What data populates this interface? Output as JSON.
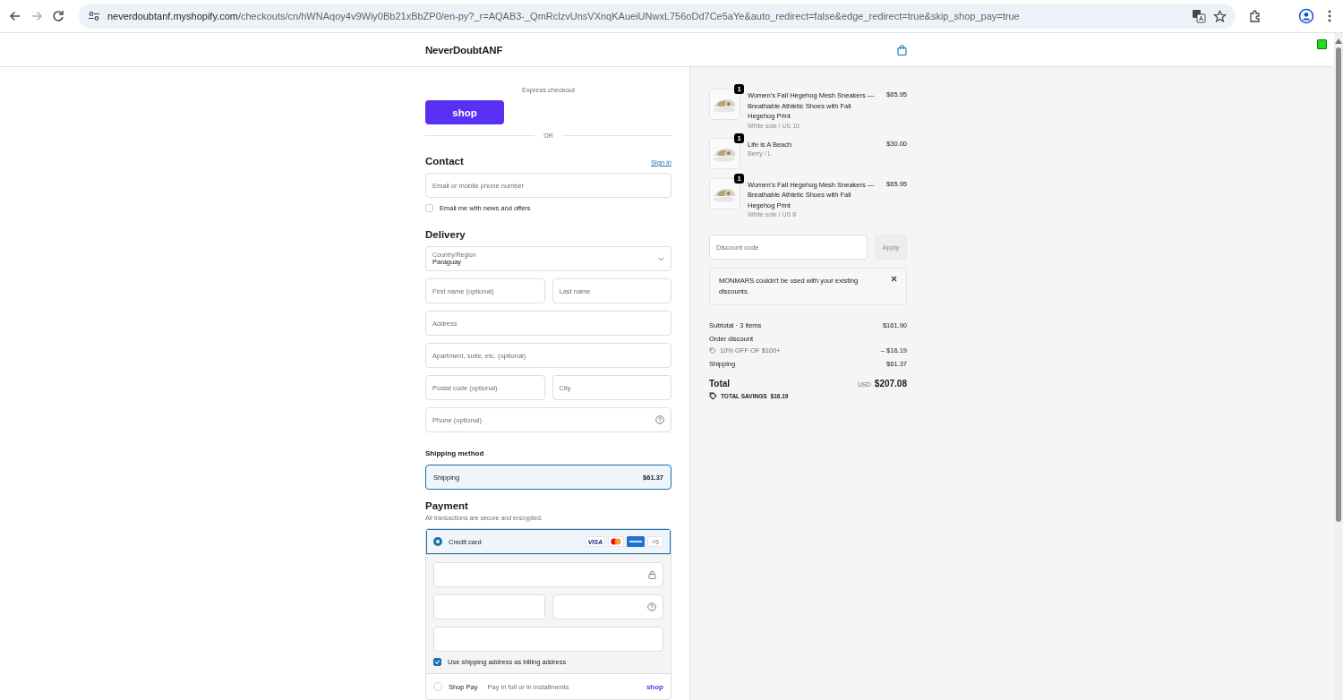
{
  "browser": {
    "url": {
      "host": "neverdoubtanf.myshopify.com",
      "path": "/checkouts/cn/hWNAqoy4v9Wiy0Bb21xBbZP0/en-py?_r=AQAB3-_QmRclzvUnsVXnqKAueiUNwxL756oDd7Ce5aYe&auto_redirect=false&edge_redirect=true&skip_shop_pay=true"
    }
  },
  "header": {
    "store_name": "NeverDoubtANF"
  },
  "express": {
    "label": "Express checkout",
    "button": "shop",
    "divider": "OR"
  },
  "contact": {
    "title": "Contact",
    "sign_in": "Sign in",
    "email_placeholder": "Email or mobile phone number",
    "newsletter": {
      "label": "Email me with news and offers",
      "checked": false
    }
  },
  "delivery": {
    "title": "Delivery",
    "rows": [
      [
        {
          "kind": "select",
          "label": "Country/Region",
          "value": "Paraguay"
        }
      ],
      [
        {
          "kind": "text",
          "placeholder": "First name (optional)"
        },
        {
          "kind": "text",
          "placeholder": "Last name"
        }
      ],
      [
        {
          "kind": "text",
          "placeholder": "Address"
        }
      ],
      [
        {
          "kind": "text",
          "placeholder": "Apartment, suite, etc. (optional)"
        }
      ],
      [
        {
          "kind": "text",
          "placeholder": "Postal code (optional)"
        },
        {
          "kind": "text",
          "placeholder": "City"
        }
      ],
      [
        {
          "kind": "text",
          "placeholder": "Phone (optional)",
          "help": true
        }
      ]
    ]
  },
  "shipping_method": {
    "title": "Shipping method",
    "options": [
      {
        "label": "Shipping",
        "price": "$61.37",
        "selected": true
      }
    ]
  },
  "payment": {
    "title": "Payment",
    "subtitle": "All transactions are secure and encrypted.",
    "methods": [
      {
        "kind": "card",
        "label": "Credit card",
        "selected": true,
        "brands": [
          {
            "kind": "visa",
            "text": "VISA"
          },
          {
            "kind": "mastercard"
          },
          {
            "kind": "amex"
          }
        ],
        "more": "+5",
        "field_rows": [
          [
            {
              "lock": true
            }
          ],
          [
            {
              "help": false
            },
            {
              "help": true
            }
          ],
          [
            {
              "lock": false
            }
          ]
        ],
        "billing": {
          "label": "Use shipping address as billing address",
          "checked": true
        }
      },
      {
        "kind": "shoppay",
        "label": "Shop Pay",
        "note": "Pay in full or in installments",
        "logo": "shop",
        "selected": false
      }
    ]
  },
  "summary": {
    "items": [
      {
        "quantity": "1",
        "title": "Women's Fall Hegehog Mesh Sneakers — Breathable Athletic Shoes with Fall Hegehog Print",
        "variant": "White sole / US 10",
        "price": "$65.95"
      },
      {
        "quantity": "1",
        "title": "Life is A Beach",
        "variant": "Berry / L",
        "price": "$30.00"
      },
      {
        "quantity": "1",
        "title": "Women's Fall Hegehog Mesh Sneakers — Breathable Athletic Shoes with Fall Hegehog Print",
        "variant": "White sole / US 8",
        "price": "$65.95"
      }
    ],
    "discount": {
      "placeholder": "Discount code",
      "button": "Apply"
    },
    "notice": "MONMARS couldn't be used with your existing discounts.",
    "subtotal": {
      "label": "Subtotal · 3 items",
      "value": "$161.90"
    },
    "order_discount": {
      "label": "Order discount",
      "code": "10% OFF OF $100+",
      "value": "– $16.19"
    },
    "shipping": {
      "label": "Shipping",
      "value": "$61.37"
    },
    "total": {
      "label": "Total",
      "currency": "USD",
      "value": "$207.08"
    },
    "savings": {
      "label": "TOTAL SAVINGS",
      "value": "$16.19"
    }
  }
}
